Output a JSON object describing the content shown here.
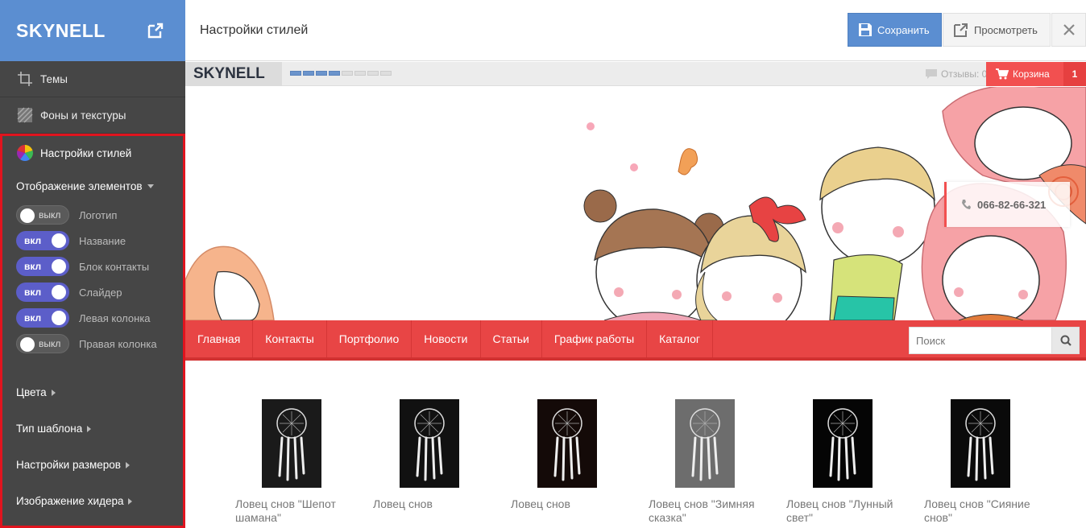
{
  "sidebar": {
    "brand": "SKYNELL",
    "nav": [
      {
        "label": "Темы",
        "icon": "crop-icon"
      },
      {
        "label": "Фоны и текстуры",
        "icon": "texture-icon"
      }
    ],
    "style_panel": {
      "title": "Настройки стилей",
      "elements_head": "Отображение элементов",
      "toggles": [
        {
          "state": "выкл",
          "on": false,
          "label": "Логотип"
        },
        {
          "state": "вкл",
          "on": true,
          "label": "Название"
        },
        {
          "state": "вкл",
          "on": true,
          "label": "Блок контакты"
        },
        {
          "state": "вкл",
          "on": true,
          "label": "Слайдер"
        },
        {
          "state": "вкл",
          "on": true,
          "label": "Левая колонка"
        },
        {
          "state": "выкл",
          "on": false,
          "label": "Правая колонка"
        }
      ],
      "sections": [
        "Цвета",
        "Тип шаблона",
        "Настройки размеров",
        "Изображение хидера"
      ]
    }
  },
  "topbar": {
    "title": "Настройки стилей",
    "save_label": "Сохранить",
    "preview_label": "Просмотреть"
  },
  "preview": {
    "logo": "SKYNELL",
    "reviews": "Отзывы: 0",
    "cart_label": "Корзина",
    "cart_count": "1",
    "phone": "066-82-66-321",
    "menu": [
      "Главная",
      "Контакты",
      "Портфолио",
      "Новости",
      "Статьи",
      "График работы",
      "Каталог"
    ],
    "search_placeholder": "Поиск",
    "products": [
      {
        "name": "Ловец снов \"Шепот шамана\""
      },
      {
        "name": "Ловец снов"
      },
      {
        "name": "Ловец снов"
      },
      {
        "name": "Ловец снов \"Зимняя сказка\""
      },
      {
        "name": "Ловец снов \"Лунный свет\""
      },
      {
        "name": "Ловец снов \"Сияние снов\""
      }
    ]
  },
  "colors": {
    "accent_blue": "#5b8ed1",
    "sidebar_bg": "#464646",
    "menu_red": "#e84545",
    "toggle_on": "#5c5ec9",
    "highlight_border": "#e0141e"
  }
}
